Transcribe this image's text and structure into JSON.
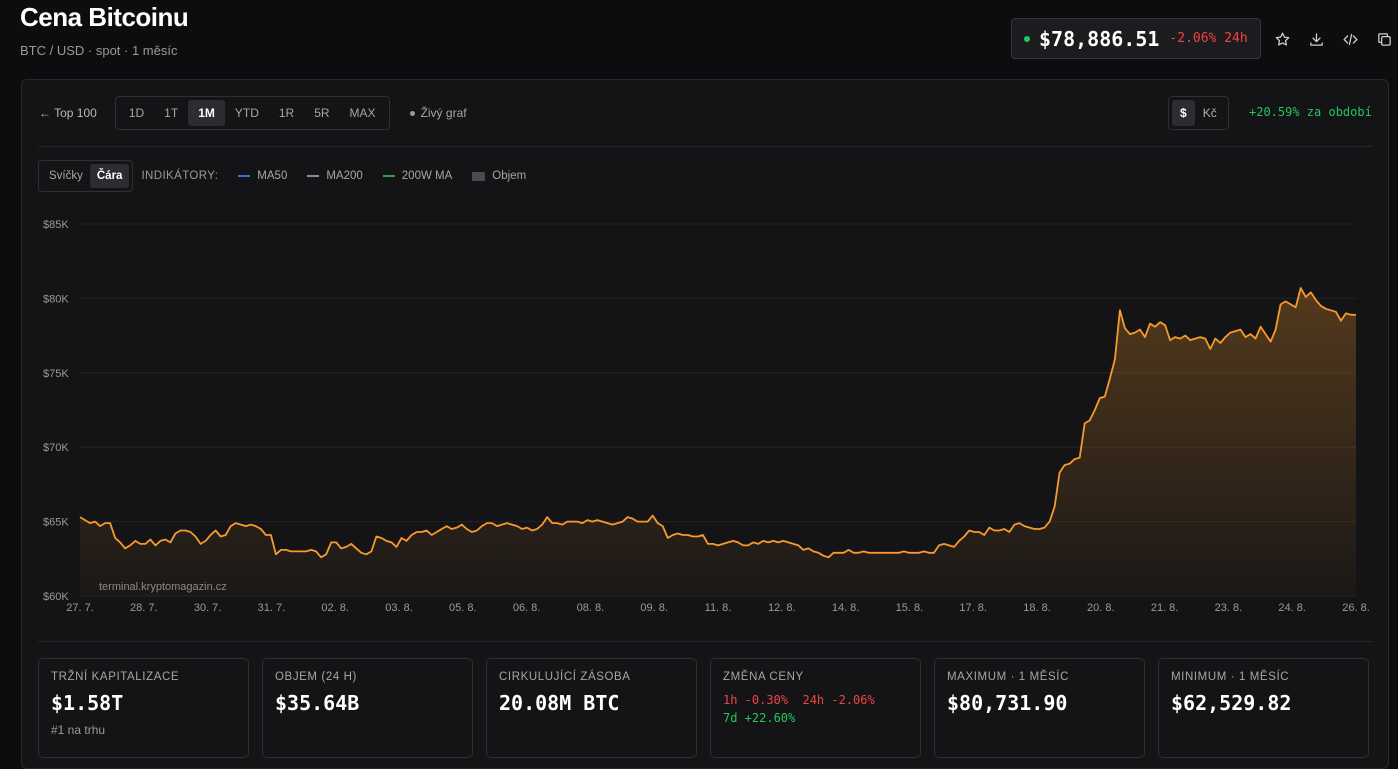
{
  "header": {
    "title": "Cena Bitcoinu",
    "subtitle": "BTC / USD · spot · 1 měsíc"
  },
  "price": {
    "value": "$78,886.51",
    "change": "-2.06% 24h"
  },
  "toolbar": {
    "back": "← Top 100",
    "ranges": [
      "1D",
      "1T",
      "1M",
      "YTD",
      "1R",
      "5R",
      "MAX"
    ],
    "active_range": "1M",
    "live": "Živý graf",
    "currencies": [
      "$",
      "Kč"
    ],
    "period_change": "+20.59% za období"
  },
  "chart_toolbar": {
    "types": [
      "Svíčky",
      "Čára"
    ],
    "indicators_label": "INDIKÁTORY:",
    "indicators": [
      {
        "name": "MA50",
        "color": "#3b6fd6"
      },
      {
        "name": "MA200",
        "color": "#8a8a93"
      },
      {
        "name": "200W MA",
        "color": "#2f9e4b"
      },
      {
        "name": "Objem",
        "color": "#4a4a4f"
      }
    ]
  },
  "chart_data": {
    "type": "area",
    "line_color": "#f79a2d",
    "watermark": "terminal.kryptomagazin.cz",
    "ylim": [
      60000,
      85000
    ],
    "y_ticks": [
      60000,
      65000,
      70000,
      75000,
      80000,
      85000
    ],
    "y_tick_labels": [
      "$60K",
      "$65K",
      "$70K",
      "$75K",
      "$80K",
      "$85K"
    ],
    "x_tick_labels": [
      "27. 7.",
      "28. 7.",
      "30. 7.",
      "31. 7.",
      "02. 8.",
      "03. 8.",
      "05. 8.",
      "06. 8.",
      "08. 8.",
      "09. 8.",
      "11. 8.",
      "12. 8.",
      "14. 8.",
      "15. 8.",
      "17. 8.",
      "18. 8.",
      "20. 8.",
      "21. 8.",
      "23. 8.",
      "24. 8.",
      "26. 8."
    ],
    "series": [
      {
        "values": [
          65300,
          65100,
          64900,
          65000,
          64700,
          64900,
          64900,
          63900,
          63600,
          63200,
          63400,
          63700,
          63500,
          63500,
          63800,
          63400,
          63700,
          63800,
          63600,
          64200,
          64400,
          64400,
          64300,
          64000,
          63500,
          63700,
          64100,
          64400,
          64000,
          64100,
          64700,
          64900,
          64800,
          64700,
          64800,
          64700,
          64500,
          64100,
          64100,
          62800,
          63100,
          63100,
          63000,
          63000,
          63000,
          63000,
          63100,
          63000,
          62600,
          62800,
          63600,
          63600,
          63200,
          63300,
          63500,
          63200,
          62900,
          62800,
          63000,
          64000,
          63900,
          63700,
          63600,
          63300,
          63900,
          63700,
          64100,
          64300,
          64300,
          64400,
          64100,
          64300,
          64500,
          64700,
          64500,
          64600,
          64800,
          64500,
          64300,
          64400,
          64700,
          64900,
          64900,
          64700,
          64800,
          64900,
          64800,
          64700,
          64500,
          64600,
          64400,
          64500,
          64800,
          65300,
          64900,
          64900,
          64800,
          65000,
          65000,
          65000,
          64900,
          65100,
          65000,
          65100,
          65000,
          64900,
          64800,
          64900,
          65000,
          65300,
          65200,
          65000,
          65000,
          65000,
          65400,
          64900,
          64700,
          63900,
          64100,
          64200,
          64100,
          64100,
          64000,
          64000,
          64100,
          63500,
          63500,
          63400,
          63500,
          63600,
          63700,
          63600,
          63400,
          63400,
          63600,
          63500,
          63700,
          63600,
          63700,
          63600,
          63700,
          63600,
          63500,
          63400,
          63100,
          63200,
          63000,
          62900,
          62700,
          62600,
          62900,
          62900,
          62900,
          63100,
          62900,
          62900,
          63000,
          62900,
          62900,
          62900,
          62900,
          62900,
          62900,
          62900,
          63000,
          62900,
          62900,
          62900,
          63000,
          62900,
          62900,
          63400,
          63500,
          63400,
          63300,
          63700,
          64000,
          64400,
          64300,
          64300,
          64100,
          64600,
          64400,
          64400,
          64500,
          64300,
          64800,
          64900,
          64700,
          64600,
          64500,
          64500,
          64600,
          65000,
          66000,
          68300,
          68800,
          68900,
          69200,
          69300,
          71600,
          71800,
          72500,
          73300,
          73400,
          74600,
          75900,
          79200,
          78000,
          77600,
          77700,
          77900,
          77400,
          78300,
          78100,
          78400,
          78200,
          77200,
          77400,
          77300,
          77500,
          77200,
          77300,
          77400,
          77300,
          76600,
          77300,
          77000,
          77400,
          77700,
          77800,
          77900,
          77400,
          77600,
          77300,
          78100,
          77600,
          77100,
          77900,
          79600,
          79800,
          79600,
          79400,
          80700,
          80100,
          80400,
          79900,
          79500,
          79300,
          79200,
          79100,
          78500,
          79000,
          78900,
          78900
        ]
      }
    ]
  },
  "stats": [
    {
      "label": "TRŽNÍ KAPITALIZACE",
      "value": "$1.58T",
      "sub": "#1 na trhu"
    },
    {
      "label": "OBJEM (24 H)",
      "value": "$35.64B"
    },
    {
      "label": "CIRKULUJÍCÍ ZÁSOBA",
      "value": "20.08M BTC"
    },
    {
      "label": "ZMĚNA CENY",
      "changes": [
        {
          "text": "1h -0.30%",
          "tone": "neg"
        },
        {
          "text": "24h -2.06%",
          "tone": "neg"
        },
        {
          "text": "7d +22.60%",
          "tone": "pos"
        }
      ]
    },
    {
      "label": "MAXIMUM · 1 MĚSÍC",
      "value": "$80,731.90"
    },
    {
      "label": "MINIMUM · 1 MĚSÍC",
      "value": "$62,529.82"
    }
  ]
}
